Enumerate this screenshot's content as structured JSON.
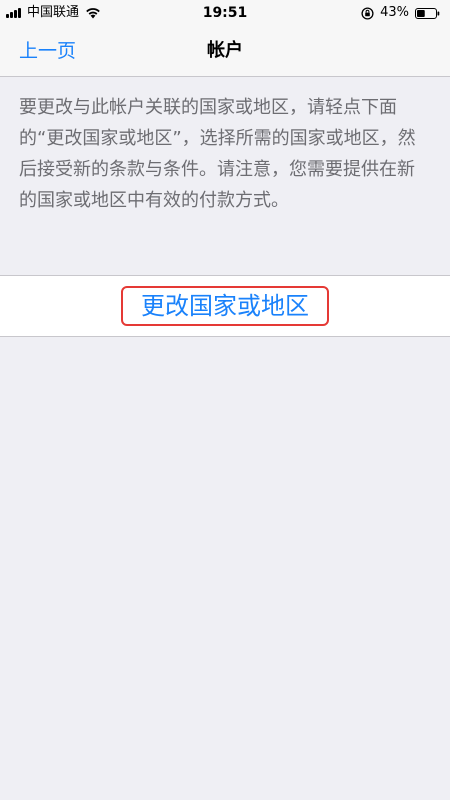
{
  "status_bar": {
    "carrier": "中国联通",
    "time": "19:51",
    "battery_percent": "43%",
    "signal_icon": "signal-bars-icon",
    "wifi_icon": "wifi-icon",
    "rotation_lock_icon": "rotation-lock-icon",
    "battery_icon": "battery-icon",
    "battery_level": 0.43
  },
  "nav": {
    "back_label": "上一页",
    "title": "帐户"
  },
  "content": {
    "description": "要更改与此帐户关联的国家或地区，请轻点下面的“更改国家或地区”，选择所需的国家或地区，然后接受新的条款与条件。请注意，您需要提供在新的国家或地区中有效的付款方式。",
    "change_button_label": "更改国家或地区"
  },
  "colors": {
    "accent": "#1a82fb",
    "background": "#efeff4",
    "highlight_border": "#e53935",
    "secondary_text": "#6d6d72"
  }
}
